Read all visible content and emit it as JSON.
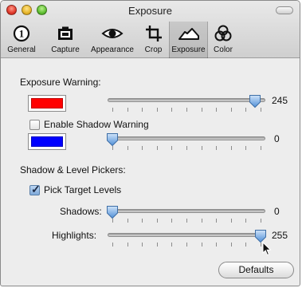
{
  "window": {
    "title": "Exposure"
  },
  "toolbar": {
    "items": [
      {
        "label": "General",
        "icon": "info-circle-icon"
      },
      {
        "label": "Capture",
        "icon": "camera-icon"
      },
      {
        "label": "Appearance",
        "icon": "eye-icon"
      },
      {
        "label": "Crop",
        "icon": "crop-icon"
      },
      {
        "label": "Exposure",
        "icon": "exposure-curve-icon"
      },
      {
        "label": "Color",
        "icon": "color-circles-icon"
      }
    ],
    "selected": "Exposure"
  },
  "exposure_warning": {
    "heading": "Exposure Warning:",
    "color": "#ff0000",
    "value": 245,
    "value_text": "245",
    "min": 0,
    "max": 255
  },
  "shadow_warning": {
    "checkbox_label": "Enable Shadow Warning",
    "checked": false,
    "color": "#0000ff",
    "value": 0,
    "value_text": "0",
    "min": 0,
    "max": 255
  },
  "pickers": {
    "heading": "Shadow & Level Pickers:",
    "checkbox_label": "Pick Target Levels",
    "checked": true,
    "shadows": {
      "label": "Shadows:",
      "value": 0,
      "value_text": "0",
      "min": 0,
      "max": 255
    },
    "highlights": {
      "label": "Highlights:",
      "value": 255,
      "value_text": "255",
      "min": 0,
      "max": 255
    }
  },
  "defaults_button": {
    "label": "Defaults"
  },
  "colors": {
    "selected_tool_bg": "#d4d4d4",
    "thumb_blue": "#4f8fd8"
  }
}
